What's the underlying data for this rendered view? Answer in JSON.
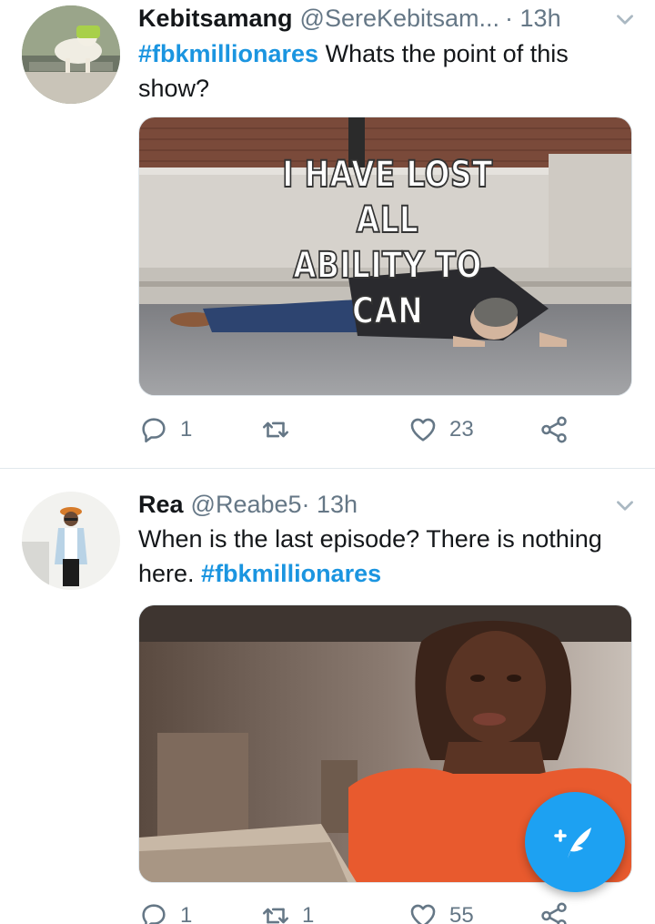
{
  "tweets": [
    {
      "name": "Kebitsamang",
      "handle": "@SereKebitsam...",
      "time": "· 13h",
      "hashtag": "#fbkmillionares",
      "text": " Whats the point of this show?",
      "image_caption_line1": "I HAVE LOST ALL",
      "image_caption_line2": "ABILITY TO CAN",
      "replies": "1",
      "retweets": "",
      "likes": "23"
    },
    {
      "name": "Rea",
      "handle": "@Reabe5",
      "time": " · 13h",
      "text": "When is the last episode? There is nothing here. ",
      "hashtag": "#fbkmillionares",
      "replies": "1",
      "retweets": "1",
      "likes": "55"
    }
  ],
  "icons": {
    "reply": "reply-icon",
    "retweet": "retweet-icon",
    "like": "heart-icon",
    "share": "share-icon",
    "more": "chevron-down-icon",
    "compose": "compose-tweet-icon"
  },
  "colors": {
    "accent": "#1da1f2",
    "hashtag": "#1b95e0",
    "muted": "#657786",
    "divider": "#e1e8ed"
  }
}
